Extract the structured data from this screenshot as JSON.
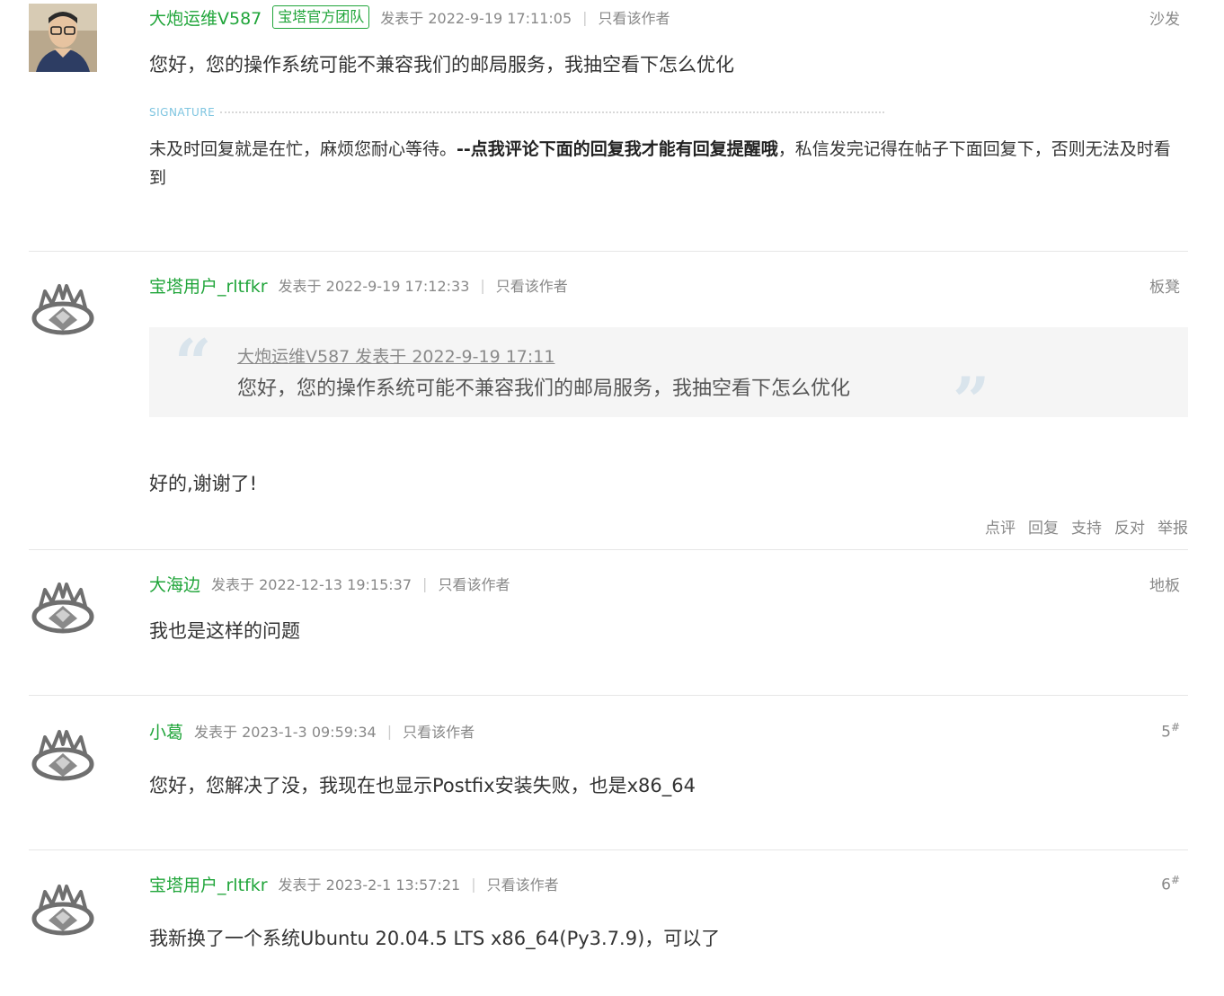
{
  "posts": [
    {
      "author": "大炮运维V587",
      "badge": "宝塔官方团队",
      "time": "发表于 2022-9-19 17:11:05",
      "sep": "|",
      "only_author": "只看该作者",
      "floor": "沙发",
      "content": "您好，您的操作系统可能不兼容我们的邮局服务，我抽空看下怎么优化",
      "signature": {
        "label": "SIGNATURE",
        "text_before": "未及时回复就是在忙，麻烦您耐心等待。",
        "text_bold": "--点我评论下面的回复我才能有回复提醒哦",
        "text_after": "，私信发完记得在帖子下面回复下，否则无法及时看到"
      }
    },
    {
      "author": "宝塔用户_rltfkr",
      "time": "发表于 2022-9-19 17:12:33",
      "sep": "|",
      "only_author": "只看该作者",
      "floor": "板凳",
      "quote": {
        "source": "大炮运维V587 发表于 2022-9-19 17:11",
        "text": "您好，您的操作系统可能不兼容我们的邮局服务，我抽空看下怎么优化",
        "open_mark": "“",
        "close_mark": "”"
      },
      "content": "好的,谢谢了!",
      "actions": [
        "点评",
        "回复",
        "支持",
        "反对",
        "举报"
      ]
    },
    {
      "author": "大海边",
      "time": "发表于 2022-12-13 19:15:37",
      "sep": "|",
      "only_author": "只看该作者",
      "floor": "地板",
      "content": "我也是这样的问题"
    },
    {
      "author": "小葛",
      "time": "发表于 2023-1-3 09:59:34",
      "sep": "|",
      "only_author": "只看该作者",
      "floor": "5",
      "floor_sup": "#",
      "content": "您好，您解决了没，我现在也显示Postfix安装失败，也是x86_64"
    },
    {
      "author": "宝塔用户_rltfkr",
      "time": "发表于 2023-2-1 13:57:21",
      "sep": "|",
      "only_author": "只看该作者",
      "floor": "6",
      "floor_sup": "#",
      "content": "我新换了一个系统Ubuntu 20.04.5 LTS x86_64(Py3.7.9)，可以了"
    }
  ],
  "colors": {
    "author_green": "#20a53a",
    "meta_gray": "#888888",
    "divider": "#e6e6e6",
    "quote_bg": "#f5f5f5",
    "signature_blue": "#7ec5e0"
  },
  "icons": {
    "staff_avatar": "person-photo-avatar",
    "default_avatar": "baota-crown-avatar"
  }
}
